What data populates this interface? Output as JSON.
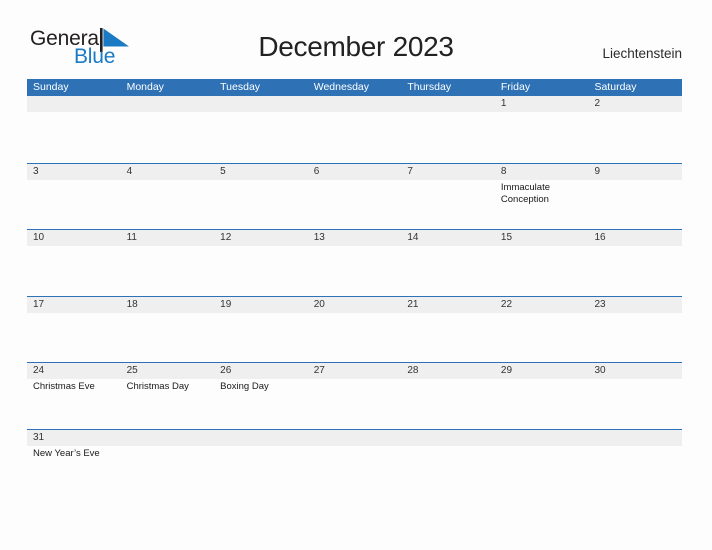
{
  "brand": {
    "name_part1": "General",
    "name_part2": "Blue",
    "flag_icon": "blue-flag-icon",
    "color_dark": "#231f20",
    "color_blue": "#1b7ac4"
  },
  "header": {
    "title": "December 2023",
    "country": "Liechtenstein"
  },
  "calendar": {
    "accent_color": "#2e72b5",
    "date_strip_color": "#efefef",
    "weekdays": [
      "Sunday",
      "Monday",
      "Tuesday",
      "Wednesday",
      "Thursday",
      "Friday",
      "Saturday"
    ],
    "weeks": [
      [
        {
          "day": "",
          "events": []
        },
        {
          "day": "",
          "events": []
        },
        {
          "day": "",
          "events": []
        },
        {
          "day": "",
          "events": []
        },
        {
          "day": "",
          "events": []
        },
        {
          "day": "1",
          "events": []
        },
        {
          "day": "2",
          "events": []
        }
      ],
      [
        {
          "day": "3",
          "events": []
        },
        {
          "day": "4",
          "events": []
        },
        {
          "day": "5",
          "events": []
        },
        {
          "day": "6",
          "events": []
        },
        {
          "day": "7",
          "events": []
        },
        {
          "day": "8",
          "events": [
            "Immaculate Conception"
          ]
        },
        {
          "day": "9",
          "events": []
        }
      ],
      [
        {
          "day": "10",
          "events": []
        },
        {
          "day": "11",
          "events": []
        },
        {
          "day": "12",
          "events": []
        },
        {
          "day": "13",
          "events": []
        },
        {
          "day": "14",
          "events": []
        },
        {
          "day": "15",
          "events": []
        },
        {
          "day": "16",
          "events": []
        }
      ],
      [
        {
          "day": "17",
          "events": []
        },
        {
          "day": "18",
          "events": []
        },
        {
          "day": "19",
          "events": []
        },
        {
          "day": "20",
          "events": []
        },
        {
          "day": "21",
          "events": []
        },
        {
          "day": "22",
          "events": []
        },
        {
          "day": "23",
          "events": []
        }
      ],
      [
        {
          "day": "24",
          "events": [
            "Christmas Eve"
          ]
        },
        {
          "day": "25",
          "events": [
            "Christmas Day"
          ]
        },
        {
          "day": "26",
          "events": [
            "Boxing Day"
          ]
        },
        {
          "day": "27",
          "events": []
        },
        {
          "day": "28",
          "events": []
        },
        {
          "day": "29",
          "events": []
        },
        {
          "day": "30",
          "events": []
        }
      ],
      [
        {
          "day": "31",
          "events": [
            "New Year’s Eve"
          ]
        },
        {
          "day": "",
          "events": []
        },
        {
          "day": "",
          "events": []
        },
        {
          "day": "",
          "events": []
        },
        {
          "day": "",
          "events": []
        },
        {
          "day": "",
          "events": []
        },
        {
          "day": "",
          "events": []
        }
      ]
    ]
  }
}
